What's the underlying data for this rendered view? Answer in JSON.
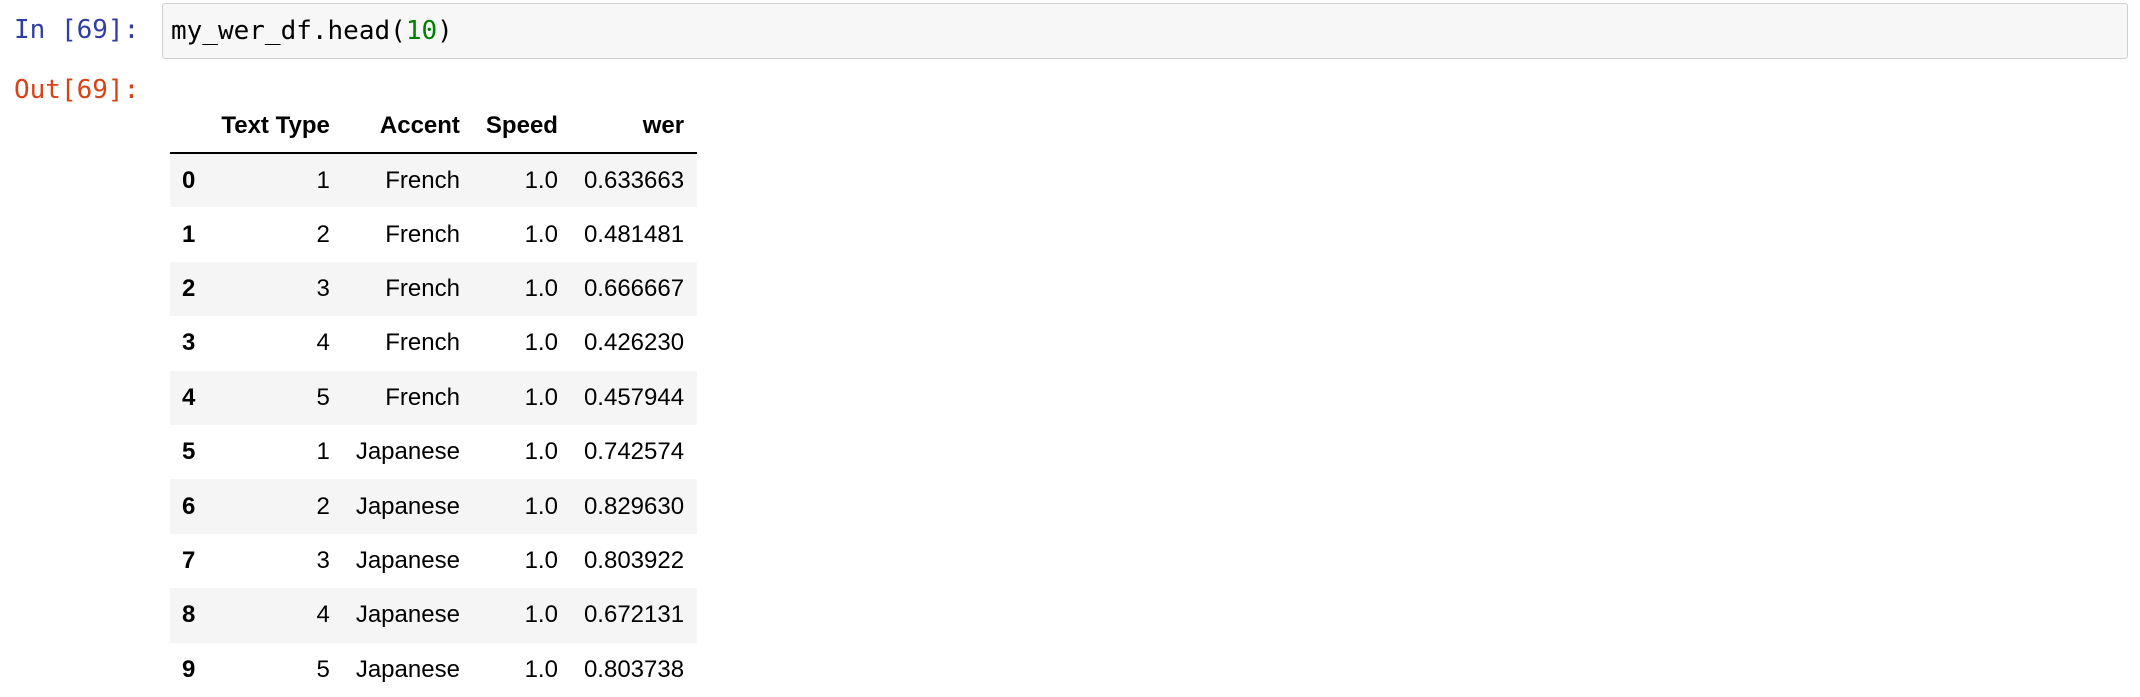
{
  "input_prompt": "In [69]:",
  "output_prompt": "Out[69]:",
  "code": {
    "text": "my_wer_df.head(",
    "arg": "10",
    "close": ")"
  },
  "table": {
    "columns": [
      "Text Type",
      "Accent",
      "Speed",
      "wer"
    ],
    "rows": [
      {
        "index": "0",
        "values": [
          "1",
          "French",
          "1.0",
          "0.633663"
        ]
      },
      {
        "index": "1",
        "values": [
          "2",
          "French",
          "1.0",
          "0.481481"
        ]
      },
      {
        "index": "2",
        "values": [
          "3",
          "French",
          "1.0",
          "0.666667"
        ]
      },
      {
        "index": "3",
        "values": [
          "4",
          "French",
          "1.0",
          "0.426230"
        ]
      },
      {
        "index": "4",
        "values": [
          "5",
          "French",
          "1.0",
          "0.457944"
        ]
      },
      {
        "index": "5",
        "values": [
          "1",
          "Japanese",
          "1.0",
          "0.742574"
        ]
      },
      {
        "index": "6",
        "values": [
          "2",
          "Japanese",
          "1.0",
          "0.829630"
        ]
      },
      {
        "index": "7",
        "values": [
          "3",
          "Japanese",
          "1.0",
          "0.803922"
        ]
      },
      {
        "index": "8",
        "values": [
          "4",
          "Japanese",
          "1.0",
          "0.672131"
        ]
      },
      {
        "index": "9",
        "values": [
          "5",
          "Japanese",
          "1.0",
          "0.803738"
        ]
      }
    ]
  },
  "colors": {
    "input_prompt": "#303f9f",
    "output_prompt": "#d84315",
    "code_number": "#008000",
    "stripe": "#f5f5f5"
  }
}
